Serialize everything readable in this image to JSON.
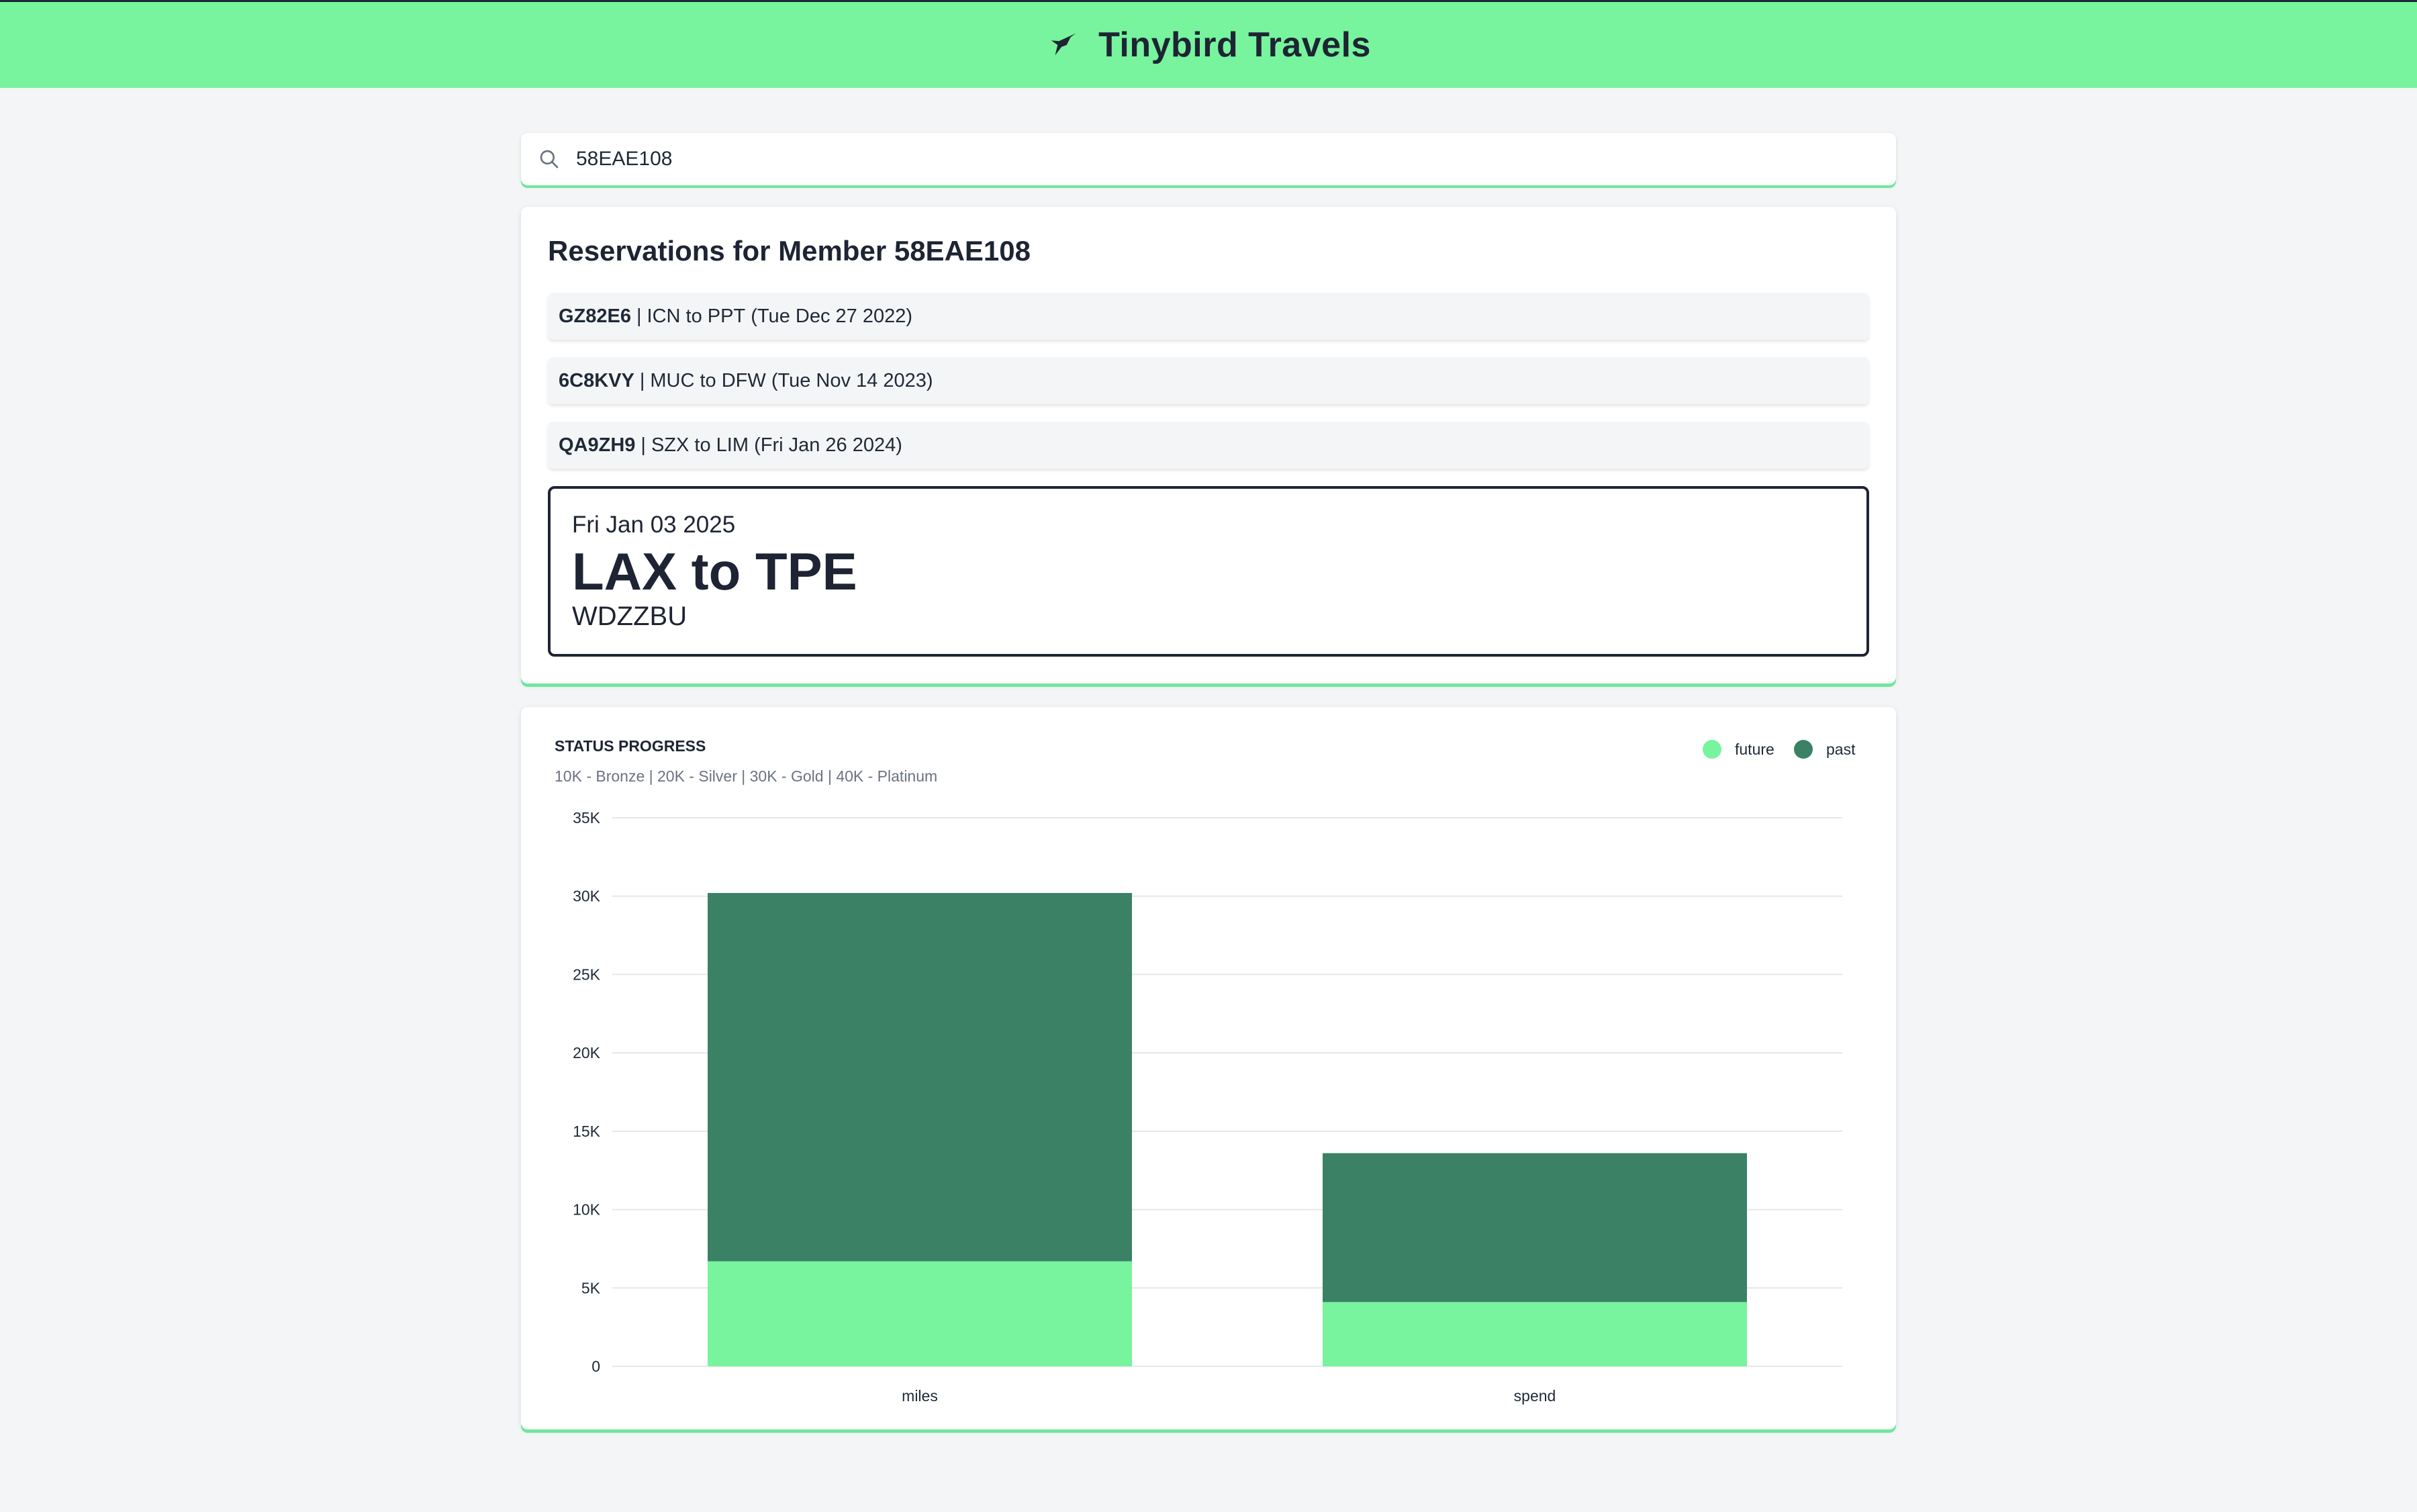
{
  "header": {
    "brand": "Tinybird Travels",
    "logo_icon": "bird-icon",
    "color": "#77f49d"
  },
  "search": {
    "value": "58EAE108",
    "icon": "search-icon"
  },
  "reservations": {
    "title": "Reservations for Member 58EAE108",
    "items": [
      {
        "code": "GZ82E6",
        "sep": "|",
        "route": "ICN to PPT",
        "date": "(Tue Dec 27 2022)"
      },
      {
        "code": "6C8KVY",
        "sep": "|",
        "route": "MUC to DFW",
        "date": "(Tue Nov 14 2023)"
      },
      {
        "code": "QA9ZH9",
        "sep": "|",
        "route": "SZX to LIM",
        "date": "(Fri Jan 26 2024)"
      }
    ],
    "selected": {
      "date": "Fri Jan 03 2025",
      "route": "LAX to TPE",
      "confirmation": "WDZZBU"
    }
  },
  "chart_data": {
    "type": "bar",
    "stacked": true,
    "title": "STATUS PROGRESS",
    "subtitle": "10K - Bronze | 20K - Silver | 30K - Gold | 40K - Platinum",
    "categories": [
      "miles",
      "spend"
    ],
    "series": [
      {
        "name": "future",
        "color": "#77f49d",
        "values": [
          6700,
          4100
        ]
      },
      {
        "name": "past",
        "color": "#3a8166",
        "values": [
          23500,
          9500
        ]
      }
    ],
    "ylim": [
      0,
      35000
    ],
    "yticks": [
      0,
      5000,
      10000,
      15000,
      20000,
      25000,
      30000,
      35000
    ],
    "ytick_labels": [
      "0",
      "5K",
      "10K",
      "15K",
      "20K",
      "25K",
      "30K",
      "35K"
    ],
    "grid": true,
    "legend": "top-right"
  }
}
